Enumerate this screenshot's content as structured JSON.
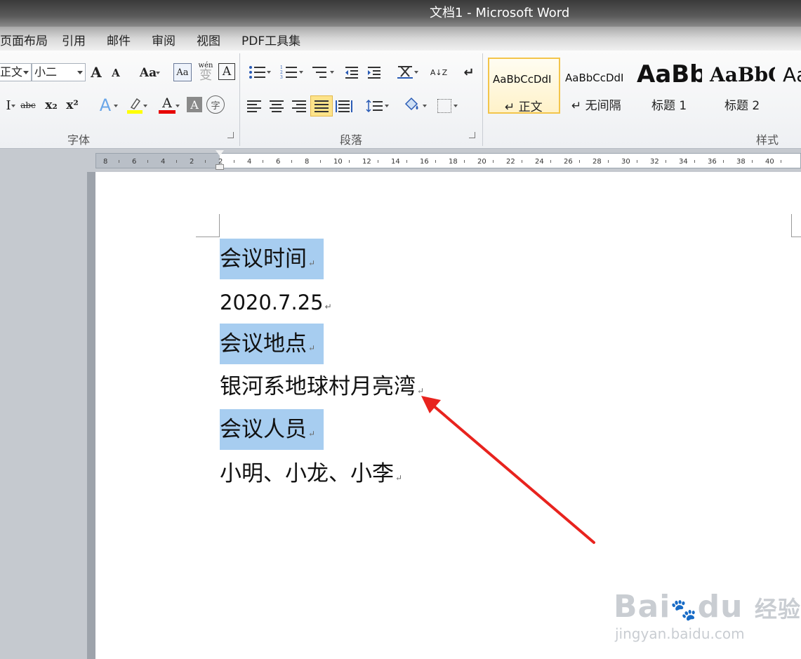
{
  "window": {
    "title": "文档1 - Microsoft Word"
  },
  "menu": {
    "tabs": [
      "页面布局",
      "引用",
      "邮件",
      "审阅",
      "视图",
      "PDF工具集"
    ]
  },
  "ribbon": {
    "font": {
      "font_name": "正文",
      "font_size": "小二",
      "grow_label": "A",
      "shrink_label": "A",
      "case_label": "Aa",
      "phonetic_label": "wén",
      "phonetic_char": "变",
      "border_char_label": "A",
      "strike_label": "abc",
      "sub_label": "x₂",
      "sup_label": "x²",
      "effects_label": "A",
      "font_color_label": "A",
      "shading_char_label": "A",
      "enclose_label": "字",
      "group_label": "字体",
      "highlight_color": "#ffff00",
      "font_color": "#e60000"
    },
    "paragraph": {
      "sort_label": "A↓Z",
      "group_label": "段落"
    },
    "styles": {
      "items": [
        {
          "sample": "AaBbCcDdI",
          "name": "正文"
        },
        {
          "sample": "AaBbCcDdI",
          "name": "无间隔"
        },
        {
          "sample": "AaBb",
          "name": "标题 1"
        },
        {
          "sample": "AaBbC",
          "name": "标题 2"
        },
        {
          "sample": "Aa",
          "name": ""
        }
      ],
      "group_label": "样式"
    }
  },
  "ruler": {
    "ticks": [
      "8",
      "6",
      "4",
      "2",
      "2",
      "4",
      "6",
      "8",
      "10",
      "12",
      "14",
      "16",
      "18",
      "20",
      "22",
      "24",
      "26",
      "28",
      "30",
      "32",
      "34",
      "36",
      "38",
      "40"
    ]
  },
  "document": {
    "paragraphs": [
      {
        "text": "会议时间",
        "highlight": true
      },
      {
        "text": "2020.7.25",
        "highlight": false
      },
      {
        "text": "会议地点",
        "highlight": true
      },
      {
        "text": "银河系地球村月亮湾",
        "highlight": false
      },
      {
        "text": "会议人员",
        "highlight": true
      },
      {
        "text": "小明、小龙、小李",
        "highlight": false
      }
    ],
    "para_mark": "↵",
    "selection_color": "#a7cdf0"
  },
  "annotation": {
    "arrow_color": "#e8231e"
  },
  "watermark": {
    "brand_a": "Bai",
    "brand_b": "du",
    "brand_c": "经验",
    "url": "jingyan.baidu.com"
  }
}
